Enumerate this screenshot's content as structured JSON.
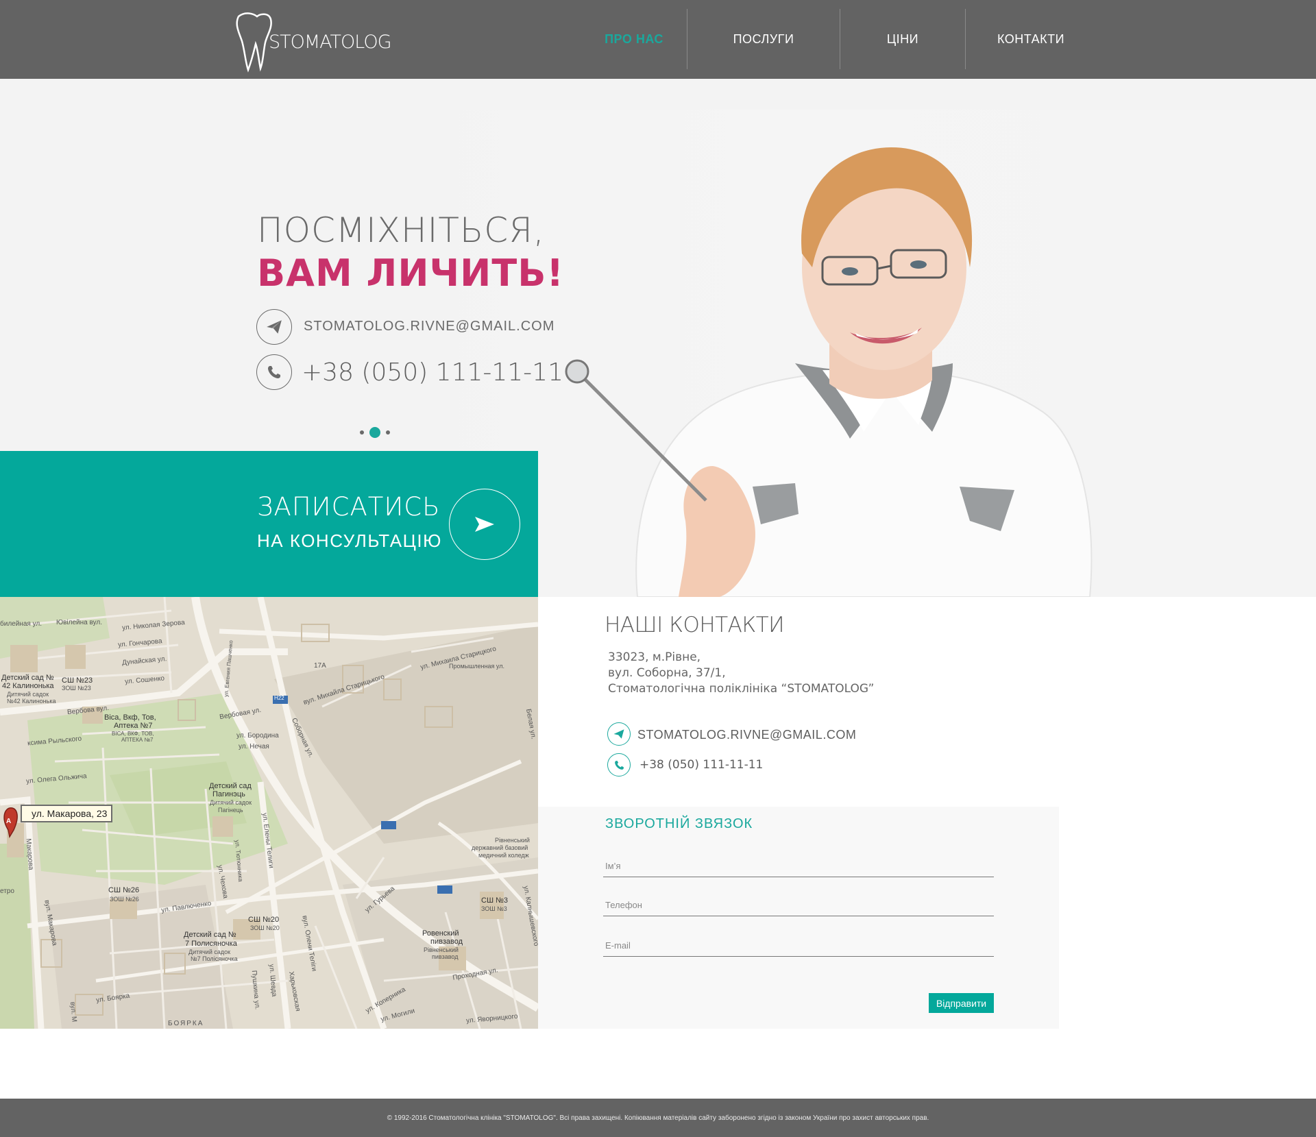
{
  "header": {
    "logo_text": "STOMATOLOG",
    "nav": [
      {
        "label": "ПРО НАС",
        "active": true
      },
      {
        "label": "ПОСЛУГИ",
        "active": false
      },
      {
        "label": "ЦІНИ",
        "active": false
      },
      {
        "label": "КОНТАКТИ",
        "active": false
      }
    ]
  },
  "hero": {
    "title_line1": "ПОСМІХНІТЬСЯ,",
    "title_line2": "ВАМ ЛИЧИТЬ!",
    "email": "STOMATOLOG.RIVNE@GMAIL.COM",
    "phone": "+38 (050) 111-11-11",
    "slider": {
      "count": 3,
      "active": 2
    },
    "photo_icon": "dentist-portrait"
  },
  "cta": {
    "line1": "ЗАПИСАТИСЬ",
    "line2": "НА КОНСУЛЬТАЦІЮ",
    "button_icon": "arrow-right-icon"
  },
  "map": {
    "marker_label": "ул. Макарова, 23",
    "labels": [
      "билейная ул.",
      "Ювілейна вул.",
      "ул. Николая Зерова",
      "ул. Гончарова",
      "Дунайская ул.",
      "ул. Сошенко",
      "Детский сад №",
      "42 Калинонька",
      "Дитячий садок",
      "№42 Калинонька",
      "СШ №23",
      "ЗОШ №23",
      "Вербова вул.",
      "Віса, Вкф, Тов,",
      "Аптека №7",
      "ВІСА, ВКФ, ТОВ,",
      "АПТЕКА №7",
      "ул. Евгения Пашченко",
      "Вербовая ул.",
      "ул. Бородина",
      "ул. Нечая",
      "Соборная ул.",
      "вул. Михайла Старицького",
      "ул. Михаила Старицкого",
      "17А",
      "Промышленная ул.",
      "H22",
      "Белая ул.",
      "ул. Олега Ольжича",
      "ксима Рыльского",
      "Детский сад",
      "Пагинэць",
      "Дитячий садок",
      "Пагінець",
      "ул. Елены Телиги",
      "ул. Тютюнника",
      "ул. Чехова",
      "вул. Макарова",
      "Макарова",
      "етро",
      "СШ №26",
      "ЗОШ №26",
      "ул. Павлюченко",
      "СШ №20",
      "ЗОШ №20",
      "Детский сад №",
      "7 Полисяночка",
      "Дитячий садок",
      "№7 Полісяночка",
      "ул. Боярка",
      "БОЯРКА",
      "Пушкина ул.",
      "ул. Шевда",
      "Харьковская",
      "Проходная ул.",
      "ул. Гурьева",
      "Рівненський",
      "державний базовий",
      "медичний коледж",
      "СШ №3",
      "ЗОШ №3",
      "Ровенский",
      "пивзавод",
      "Рівненський",
      "пивзавод",
      "ул. Коперника",
      "ул. Могили",
      "ул. Яворницкого",
      "ул. Калнышевского",
      "вул. Олени Теліги",
      "вул. М"
    ]
  },
  "contacts": {
    "title": "НАШІ КОНТАКТИ",
    "address": [
      "33023, м.Рівне,",
      "вул. Соборна, 37/1,",
      "Стоматологічна поліклініка “STOMATOLOG”"
    ],
    "email": "STOMATOLOG.RIVNE@GMAIL.COM",
    "phone": "+38 (050) 111-11-11"
  },
  "form": {
    "title": "ЗВОРОТНІЙ ЗВЯЗОК",
    "name_placeholder": "Ім’я",
    "phone_placeholder": "Телефон",
    "email_placeholder": "E-mail",
    "submit_label": "Відправити"
  },
  "footer": {
    "text": "© 1992-2016 Стоматологічна клініка \"STOMATOLOG\". Всі права захищені. Копіювання матеріалів сайту заборонено згідно із законом України про захист авторських прав."
  },
  "colors": {
    "header_bg": "#636363",
    "accent": "#04a89b",
    "headline_pink": "#c8326b",
    "hero_bg": "#f3f3f3",
    "map_bg": "#e2dccf"
  }
}
